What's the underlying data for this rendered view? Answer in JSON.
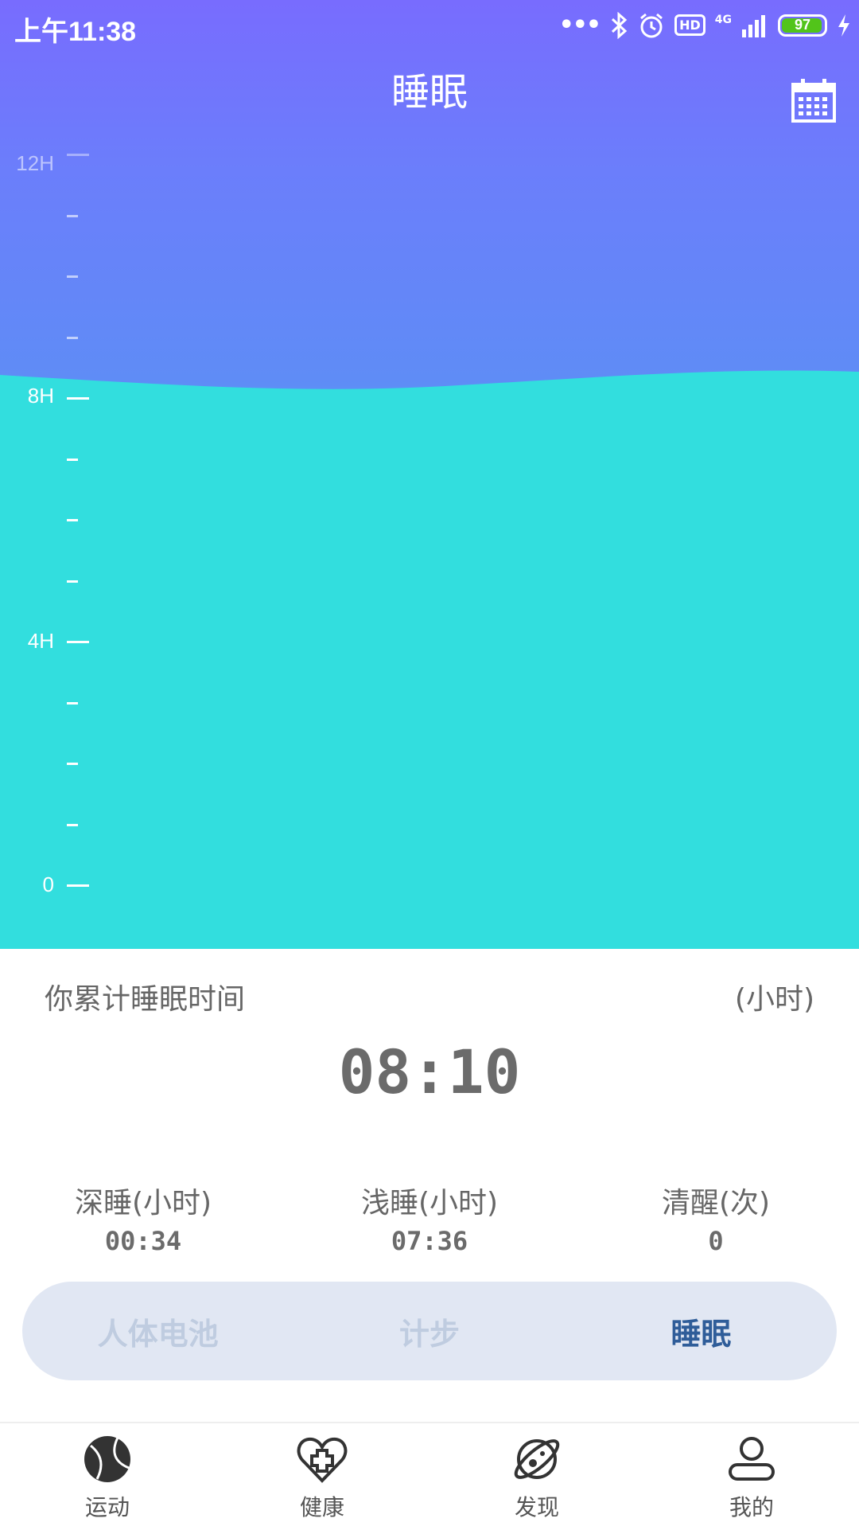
{
  "status_bar": {
    "time": "上午11:38",
    "battery_level": "97",
    "network": "4G",
    "hd": "HD"
  },
  "header": {
    "title": "睡眠"
  },
  "chart_data": {
    "type": "area",
    "y_ticks": [
      "12H",
      "8H",
      "4H",
      "0"
    ],
    "ylim": [
      0,
      12
    ],
    "value_hours": 8.17,
    "title": "",
    "xlabel": "",
    "ylabel": ""
  },
  "summary": {
    "label": "你累计睡眠时间",
    "unit": "(小时)",
    "total": "08:10"
  },
  "stats": [
    {
      "label": "深睡(小时)",
      "value": "00:34"
    },
    {
      "label": "浅睡(小时)",
      "value": "07:36"
    },
    {
      "label": "清醒(次)",
      "value": "0"
    }
  ],
  "tabs": [
    {
      "label": "人体电池",
      "active": false
    },
    {
      "label": "计步",
      "active": false
    },
    {
      "label": "睡眠",
      "active": true
    }
  ],
  "nav": [
    {
      "label": "运动",
      "icon": "sport-ball-icon"
    },
    {
      "label": "健康",
      "icon": "health-heart-icon"
    },
    {
      "label": "发现",
      "icon": "discover-planet-icon"
    },
    {
      "label": "我的",
      "icon": "profile-user-icon"
    }
  ],
  "colors": {
    "top_gradient": "#786cfe",
    "water": "#32dede",
    "tab_bg": "#e1e7f3",
    "tab_active": "#2f5d99",
    "tab_inactive": "#bfcce0"
  }
}
